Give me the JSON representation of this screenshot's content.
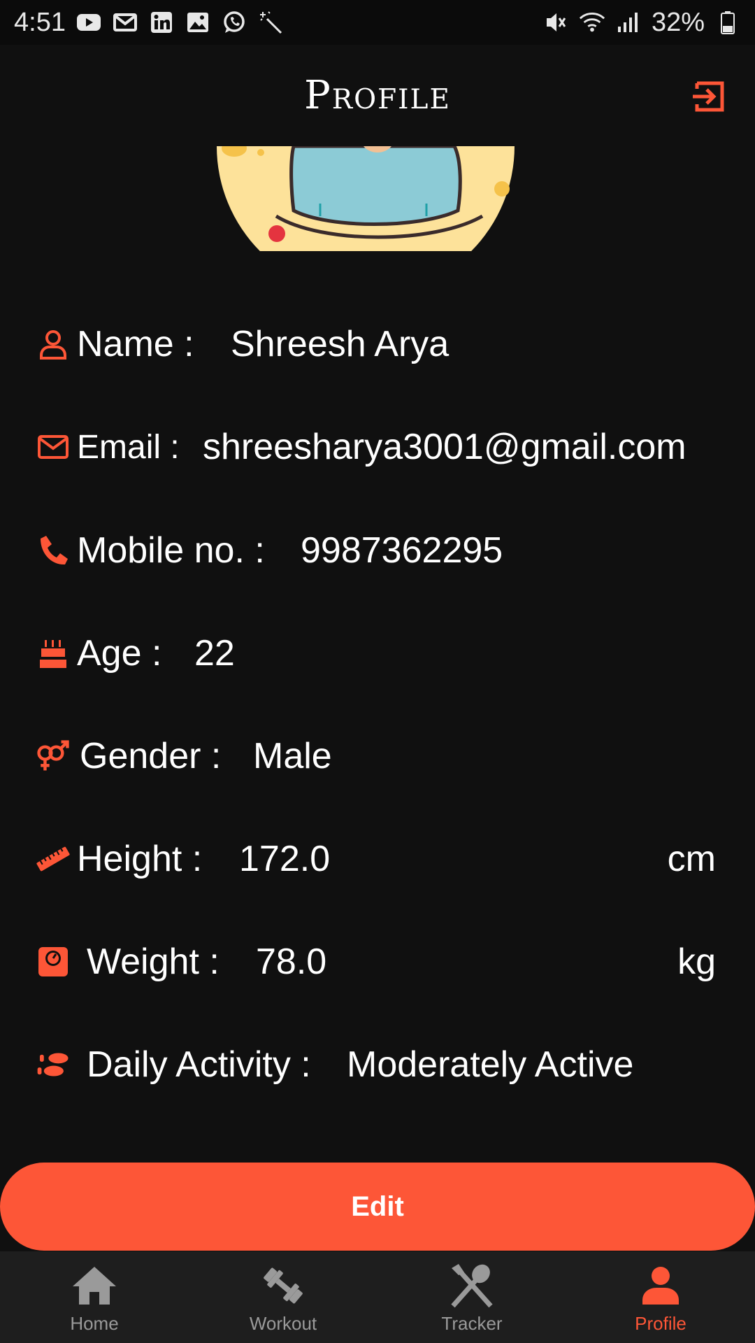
{
  "status_bar": {
    "time": "4:51",
    "battery": "32%",
    "left_icons": [
      "youtube-icon",
      "gmail-icon",
      "linkedin-icon",
      "gallery-icon",
      "whatsapp-icon",
      "magic-wand-icon"
    ],
    "right_icons": [
      "mute-icon",
      "wifi-icon",
      "signal-icon",
      "battery-icon"
    ]
  },
  "header": {
    "title": "Profile",
    "logout_icon": "logout-icon"
  },
  "accent_color": "#fd5637",
  "profile": {
    "name_label": "Name :",
    "name_value": "Shreesh Arya",
    "email_label": "Email :",
    "email_value": "shreesharya3001@gmail.com",
    "mobile_label": "Mobile no. :",
    "mobile_value": "9987362295",
    "age_label": "Age :",
    "age_value": "22",
    "gender_label": "Gender :",
    "gender_value": "Male",
    "height_label": "Height :",
    "height_value": "172.0",
    "height_unit": "cm",
    "weight_label": "Weight :",
    "weight_value": "78.0",
    "weight_unit": "kg",
    "activity_label": "Daily Activity :",
    "activity_value": "Moderately Active"
  },
  "edit_button": "Edit",
  "bottom_nav": {
    "home": "Home",
    "workout": "Workout",
    "tracker": "Tracker",
    "profile": "Profile"
  }
}
